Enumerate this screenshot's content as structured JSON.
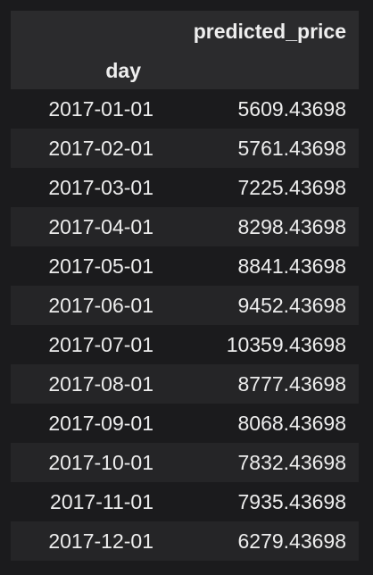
{
  "table": {
    "value_column_header": "predicted_price",
    "index_header": "day",
    "rows": [
      {
        "day": "2017-01-01",
        "predicted_price": "5609.43698"
      },
      {
        "day": "2017-02-01",
        "predicted_price": "5761.43698"
      },
      {
        "day": "2017-03-01",
        "predicted_price": "7225.43698"
      },
      {
        "day": "2017-04-01",
        "predicted_price": "8298.43698"
      },
      {
        "day": "2017-05-01",
        "predicted_price": "8841.43698"
      },
      {
        "day": "2017-06-01",
        "predicted_price": "9452.43698"
      },
      {
        "day": "2017-07-01",
        "predicted_price": "10359.43698"
      },
      {
        "day": "2017-08-01",
        "predicted_price": "8777.43698"
      },
      {
        "day": "2017-09-01",
        "predicted_price": "8068.43698"
      },
      {
        "day": "2017-10-01",
        "predicted_price": "7832.43698"
      },
      {
        "day": "2017-11-01",
        "predicted_price": "7935.43698"
      },
      {
        "day": "2017-12-01",
        "predicted_price": "6279.43698"
      }
    ]
  }
}
